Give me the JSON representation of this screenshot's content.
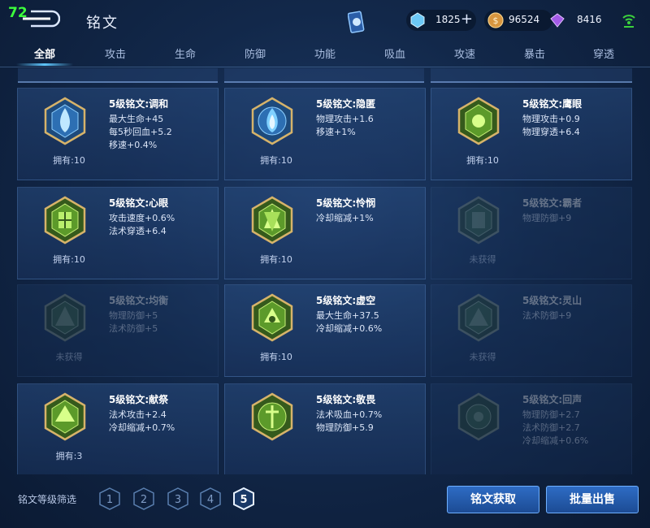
{
  "status": {
    "fps": "72"
  },
  "header": {
    "title": "铭文"
  },
  "currency": [
    {
      "name": "diamond-icon",
      "value": "1825",
      "color": "#8fd3ff"
    },
    {
      "name": "coin-icon",
      "value": "96524",
      "color": "#e0a44a"
    },
    {
      "name": "crystal-icon",
      "value": "8416",
      "color": "#b16cf0"
    }
  ],
  "tabs": [
    {
      "label": "全部"
    },
    {
      "label": "攻击"
    },
    {
      "label": "生命"
    },
    {
      "label": "防御"
    },
    {
      "label": "功能"
    },
    {
      "label": "吸血"
    },
    {
      "label": "攻速"
    },
    {
      "label": "暴击"
    },
    {
      "label": "穿透"
    }
  ],
  "runes": [
    {
      "name": "5级铭文:调和",
      "stats": [
        "最大生命+45",
        "每5秒回血+5.2",
        "移速+0.4%"
      ],
      "owned": "拥有:10",
      "color": "blue",
      "locked": false
    },
    {
      "name": "5级铭文:隐匿",
      "stats": [
        "物理攻击+1.6",
        "移速+1%"
      ],
      "owned": "拥有:10",
      "color": "blue",
      "locked": false
    },
    {
      "name": "5级铭文:鹰眼",
      "stats": [
        "物理攻击+0.9",
        "物理穿透+6.4"
      ],
      "owned": "拥有:10",
      "color": "green",
      "locked": false
    },
    {
      "name": "5级铭文:心眼",
      "stats": [
        "攻击速度+0.6%",
        "法术穿透+6.4"
      ],
      "owned": "拥有:10",
      "color": "green",
      "locked": false
    },
    {
      "name": "5级铭文:怜悯",
      "stats": [
        "冷却缩减+1%"
      ],
      "owned": "拥有:10",
      "color": "green",
      "locked": false
    },
    {
      "name": "5级铭文:霸者",
      "stats": [
        "物理防御+9"
      ],
      "owned": "未获得",
      "color": "green",
      "locked": true
    },
    {
      "name": "5级铭文:均衡",
      "stats": [
        "物理防御+5",
        "法术防御+5"
      ],
      "owned": "未获得",
      "color": "green",
      "locked": true
    },
    {
      "name": "5级铭文:虚空",
      "stats": [
        "最大生命+37.5",
        "冷却缩减+0.6%"
      ],
      "owned": "拥有:10",
      "color": "green",
      "locked": false
    },
    {
      "name": "5级铭文:灵山",
      "stats": [
        "法术防御+9"
      ],
      "owned": "未获得",
      "color": "green",
      "locked": true
    },
    {
      "name": "5级铭文:献祭",
      "stats": [
        "法术攻击+2.4",
        "冷却缩减+0.7%"
      ],
      "owned": "拥有:3",
      "color": "green",
      "locked": false
    },
    {
      "name": "5级铭文:敬畏",
      "stats": [
        "法术吸血+0.7%",
        "物理防御+5.9"
      ],
      "owned": "",
      "color": "green",
      "locked": false
    },
    {
      "name": "5级铭文:回声",
      "stats": [
        "物理防御+2.7",
        "法术防御+2.7",
        "冷却缩减+0.6%"
      ],
      "owned": "",
      "color": "green",
      "locked": true
    }
  ],
  "footer": {
    "filter_label": "铭文等级筛选",
    "levels": [
      "1",
      "2",
      "3",
      "4",
      "5"
    ],
    "active_level": "5",
    "get_button": "铭文获取",
    "sell_button": "批量出售"
  }
}
